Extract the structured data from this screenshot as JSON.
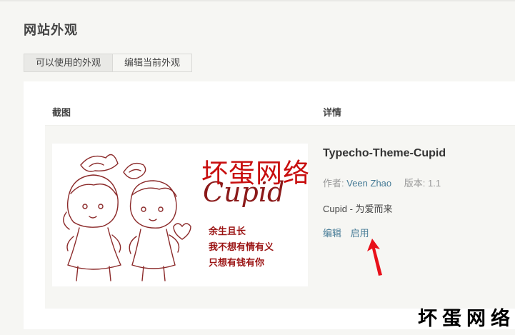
{
  "page": {
    "title": "网站外观"
  },
  "tabs": [
    {
      "label": "可以使用的外观",
      "active": true
    },
    {
      "label": "编辑当前外观",
      "active": false
    }
  ],
  "table": {
    "headers": {
      "screenshot": "截图",
      "details": "详情"
    }
  },
  "theme": {
    "name": "Typecho-Theme-Cupid",
    "author_label": "作者:",
    "author_name": "Veen Zhao",
    "version_label": "版本:",
    "version": "1.1",
    "description": "Cupid - 为爱而来",
    "actions": {
      "edit": "编辑",
      "activate": "启用"
    },
    "thumbnail": {
      "logo": "Cupid",
      "lines": [
        "余生且长",
        "我不想有情有义",
        "只想有钱有你"
      ]
    }
  },
  "watermarks": {
    "overlay": "坏蛋网络",
    "corner": "坏蛋网络"
  },
  "colors": {
    "link": "#467b96",
    "watermark_red": "#c80e0e",
    "annotation_arrow": "#e8101a"
  }
}
